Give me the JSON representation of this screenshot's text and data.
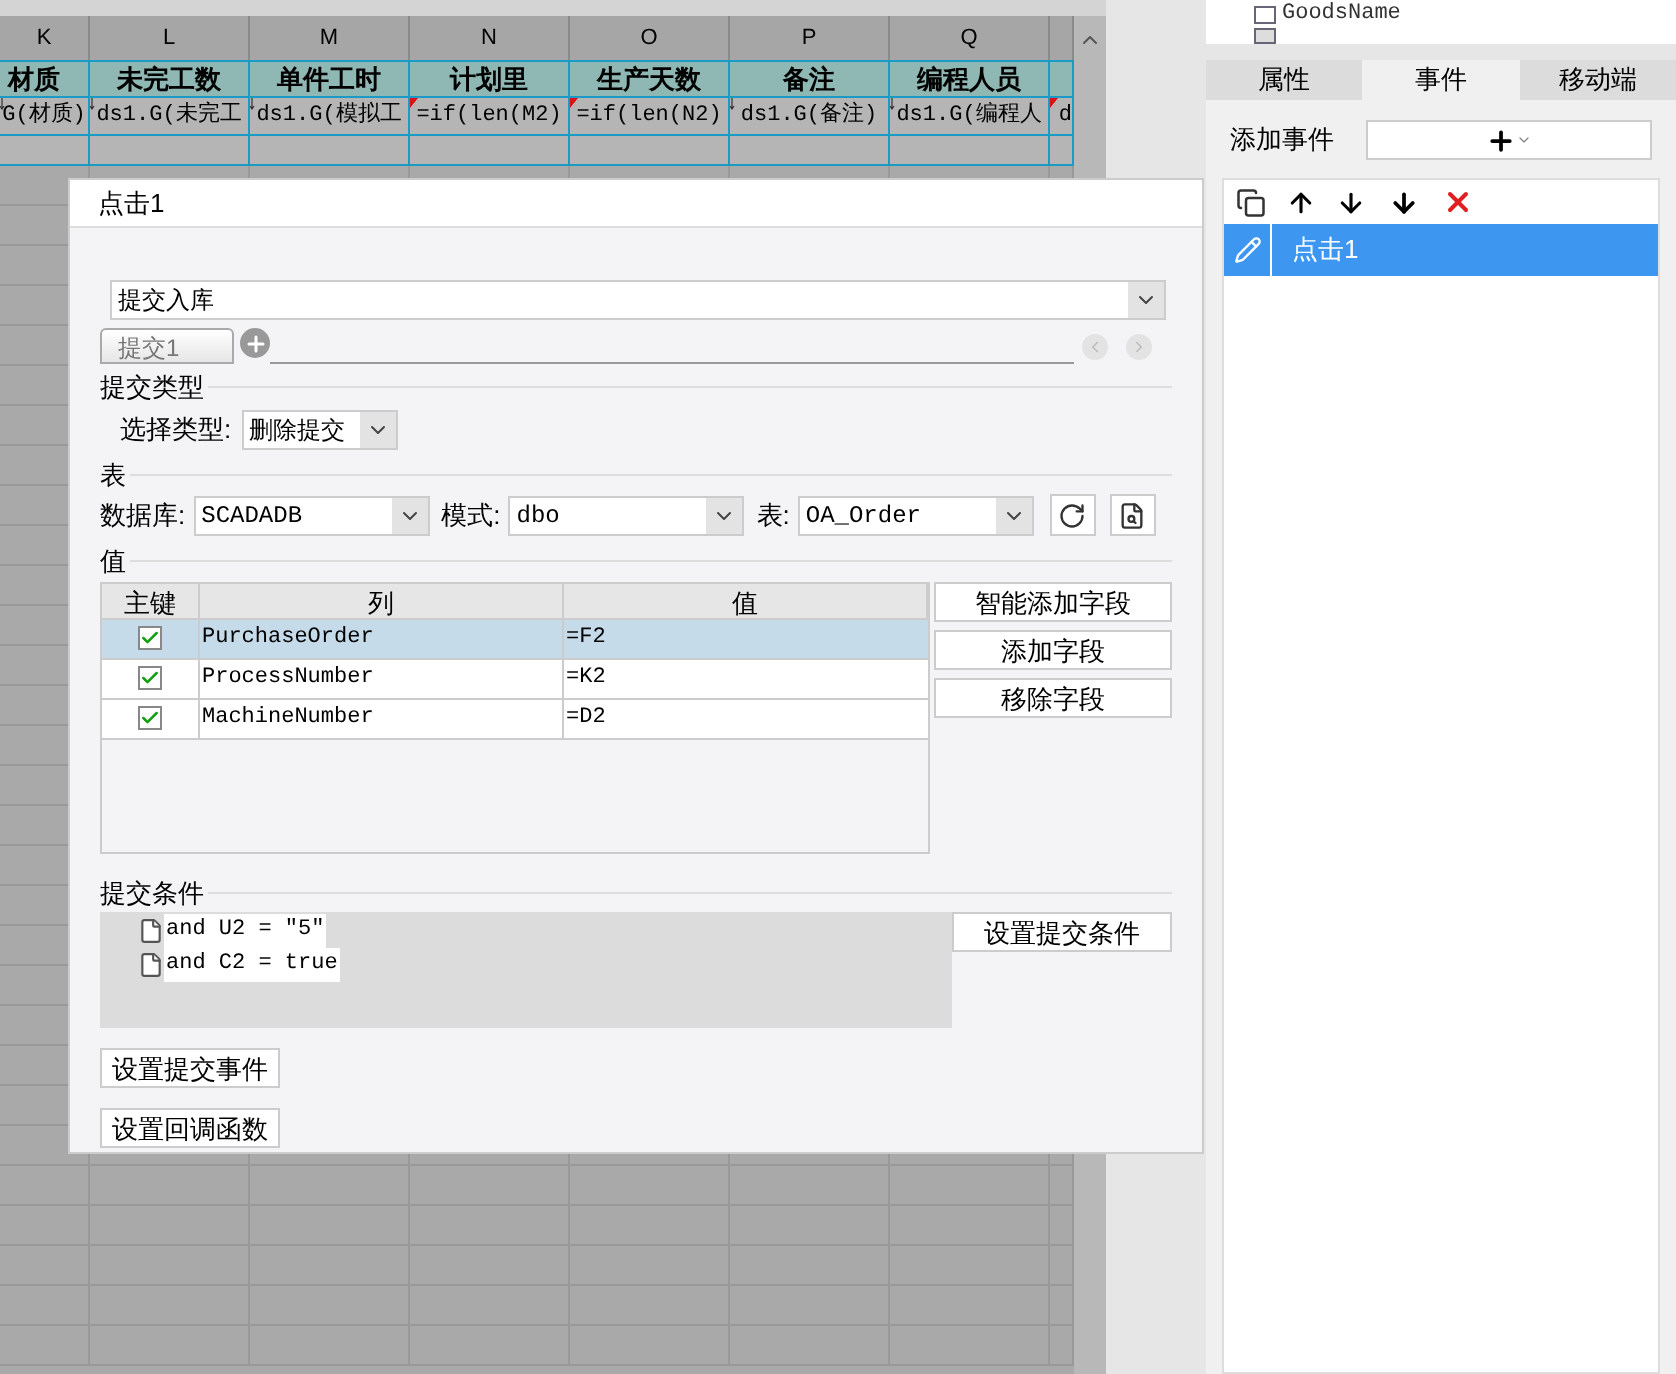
{
  "spreadsheet": {
    "columns": [
      {
        "letter": "K",
        "header": "材质",
        "formula": "G(材质)",
        "flagged": false
      },
      {
        "letter": "L",
        "header": "未完工数",
        "formula": "ds1.G(未完工",
        "flagged": false
      },
      {
        "letter": "M",
        "header": "单件工时",
        "formula": "ds1.G(模拟工",
        "flagged": false
      },
      {
        "letter": "N",
        "header": "计划里",
        "formula": "=if(len(M2)",
        "flagged": true
      },
      {
        "letter": "O",
        "header": "生产天数",
        "formula": "=if(len(N2)",
        "flagged": true
      },
      {
        "letter": "P",
        "header": "备注",
        "formula": "ds1.G(备注)",
        "flagged": false
      },
      {
        "letter": "Q",
        "header": "编程人员",
        "formula": "ds1.G(编程人",
        "flagged": false
      },
      {
        "formula": "d",
        "flagged": true
      }
    ]
  },
  "right_panel": {
    "tree_items": [
      "GoodsName"
    ],
    "tabs": [
      {
        "label": "属性",
        "selected": false
      },
      {
        "label": "事件",
        "selected": true
      },
      {
        "label": "移动端",
        "selected": false
      }
    ],
    "add_event_label": "添加事件",
    "events": [
      {
        "label": "点击1",
        "selected": true
      }
    ]
  },
  "dialog": {
    "title": "点击1",
    "action": "提交入库",
    "submit_tabs": [
      {
        "label": "提交1",
        "selected": true
      }
    ],
    "submit_type": {
      "section": "提交类型",
      "label": "选择类型:",
      "value": "删除提交"
    },
    "table": {
      "section": "表",
      "database_label": "数据库:",
      "database": "SCADADB",
      "schema_label": "模式:",
      "schema": "dbo",
      "table_label": "表:",
      "table": "OA_Order"
    },
    "values": {
      "section": "值",
      "columns": [
        "主键",
        "列",
        "值"
      ],
      "rows": [
        {
          "checked": true,
          "selected": true,
          "column": "PurchaseOrder",
          "value": "=F2"
        },
        {
          "checked": true,
          "selected": false,
          "column": "ProcessNumber",
          "value": "=K2"
        },
        {
          "checked": true,
          "selected": false,
          "column": "MachineNumber",
          "value": "=D2"
        }
      ],
      "buttons": [
        "智能添加字段",
        "添加字段",
        "移除字段"
      ]
    },
    "conditions": {
      "section": "提交条件",
      "items": [
        "and U2 = \"5\"",
        "and C2 = true"
      ],
      "button": "设置提交条件"
    },
    "bottom_buttons": [
      "设置提交事件",
      "设置回调函数"
    ]
  }
}
